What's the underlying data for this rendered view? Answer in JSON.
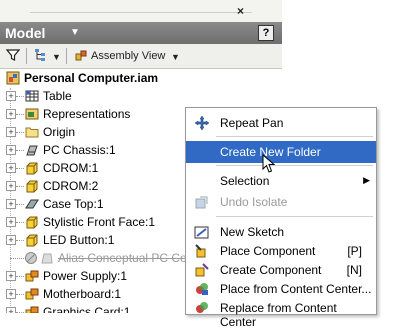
{
  "panel": {
    "title": "Model",
    "help_label": "?",
    "close_label": "×",
    "assembly_view_label": "Assembly View"
  },
  "tree": {
    "root": "Personal Computer.iam",
    "items": [
      {
        "label": "Table",
        "icon": "table-icon",
        "expander": "+"
      },
      {
        "label": "Representations",
        "icon": "representations-icon",
        "expander": "+"
      },
      {
        "label": "Origin",
        "icon": "folder-icon",
        "expander": "+"
      },
      {
        "label": "PC Chassis:1",
        "icon": "part-icon",
        "expander": "+"
      },
      {
        "label": "CDROM:1",
        "icon": "part-icon",
        "expander": "+"
      },
      {
        "label": "CDROM:2",
        "icon": "part-icon",
        "expander": "+"
      },
      {
        "label": "Case Top:1",
        "icon": "part-icon",
        "expander": "+"
      },
      {
        "label": "Stylistic Front Face:1",
        "icon": "part-icon",
        "expander": "+"
      },
      {
        "label": "LED Button:1",
        "icon": "part-icon",
        "expander": "+"
      },
      {
        "label": "Alias Conceptual PC Cover",
        "icon": "suppressed-icon",
        "expander": ""
      },
      {
        "label": "Power Supply:1",
        "icon": "assembly-icon",
        "expander": "+"
      },
      {
        "label": "Motherboard:1",
        "icon": "assembly-icon",
        "expander": "+"
      },
      {
        "label": "Graphics Card:1",
        "icon": "assembly-icon",
        "expander": "+"
      }
    ]
  },
  "context_menu": {
    "repeat_pan": "Repeat Pan",
    "create_new_folder": "Create New Folder",
    "selection": "Selection",
    "undo_isolate": "Undo Isolate",
    "new_sketch": "New Sketch",
    "place_component": "Place Component",
    "place_component_shortcut": "[P]",
    "create_component": "Create Component",
    "create_component_shortcut": "[N]",
    "place_from_content_center": "Place from Content Center...",
    "replace_from_content_center": "Replace from Content Center"
  },
  "colors": {
    "highlight": "#316ac5",
    "title_bar": "#7a7a7a"
  }
}
